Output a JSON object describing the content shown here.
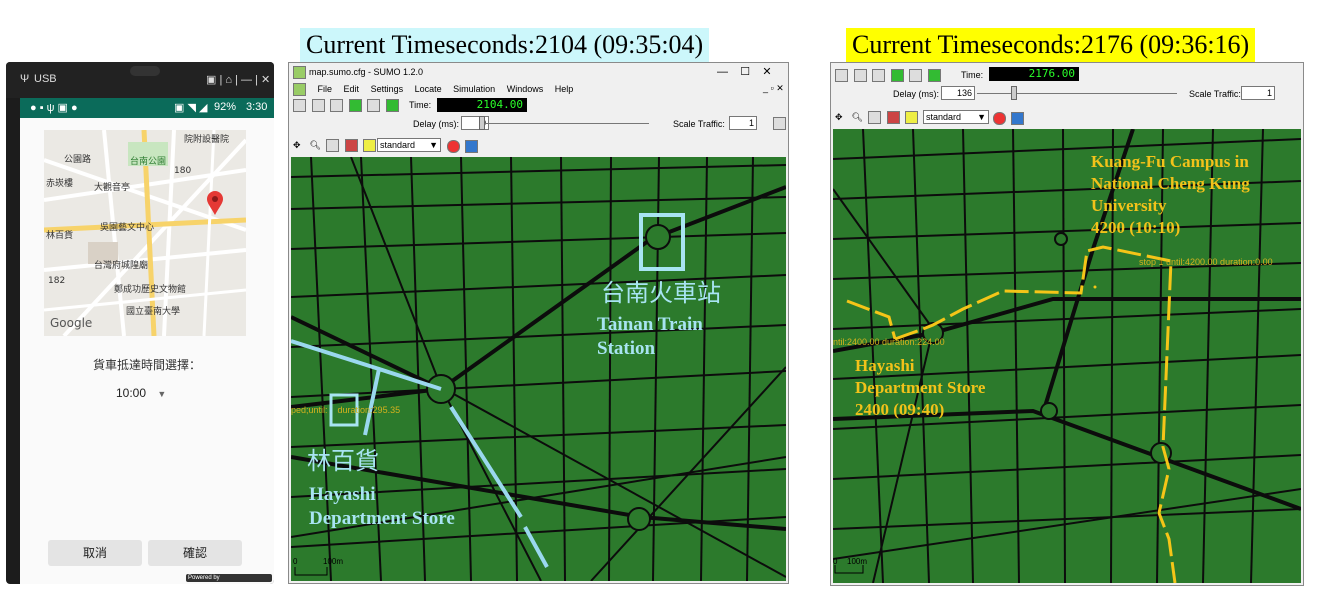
{
  "captions": {
    "left": "Current Timeseconds:2104 (09:35:04)",
    "right": "Current Timeseconds:2176 (09:36:16)",
    "left_bg": "#ccf7fb",
    "right_bg": "#ffff00"
  },
  "phone": {
    "usb": "USB",
    "status_right": "92%",
    "clock": "3:30",
    "map_labels": {
      "park": "台南公園",
      "hospital": "院附設醫院",
      "chikan": "赤崁樓",
      "daguan": "大觀音亭",
      "wu": "吳園藝文中心",
      "hayashi": "林百貨",
      "fucheng": "台灣府城隍廟",
      "gov": "鄭成功歷史文物館",
      "ntu": "國立臺南大學",
      "lot": "公園路",
      "google": "Google",
      "num180": "180",
      "num182": "182"
    },
    "arrival_label": "貨車抵達時間選擇：",
    "time_value": "10:00",
    "cancel": "取消",
    "confirm": "確認",
    "powered": "Powered by"
  },
  "sumo_left": {
    "title": "map.sumo.cfg - SUMO 1.2.0",
    "window_controls": [
      "—",
      "☐",
      "✕"
    ],
    "menu": [
      "File",
      "Edit",
      "Settings",
      "Locate",
      "Simulation",
      "Windows",
      "Help"
    ],
    "time_label": "Time:",
    "time_value": "2104.00",
    "delay_label": "Delay (ms):",
    "delay_value": "0",
    "scale_label": "Scale Traffic:",
    "scale_value": "1",
    "scheme": "standard",
    "station_zh": "台南火車站",
    "station_en": "Tainan Train\nStation",
    "store_zh": "林百貨",
    "store_en": "Hayashi\nDepartment Store",
    "stop_text": "ped;until:    duration:295.35",
    "scale_text": "100m",
    "scale_zero": "0"
  },
  "sumo_right": {
    "time_label": "Time:",
    "time_value": "2176.00",
    "delay_label": "Delay (ms):",
    "delay_value": "136",
    "scale_label": "Scale Traffic:",
    "scale_value": "1",
    "scheme": "standard",
    "campus": "Kuang-Fu Campus in\nNational Cheng Kung\nUniversity\n4200 (10:10)",
    "store": "Hayashi\nDepartment Store\n2400 (09:40)",
    "stop1": "stop 1 until:4200.00 duration:0.00",
    "stop2": "ntil:2400.00 duration:224.00",
    "scale_text": "100m",
    "scale_zero": "0"
  },
  "colors": {
    "road_green": "#2c7a2c",
    "route_blue": "#9ad8ee",
    "route_yellow": "#f5c518",
    "label_blue": "#a8e4f2",
    "label_yellow": "#f2c21a"
  }
}
